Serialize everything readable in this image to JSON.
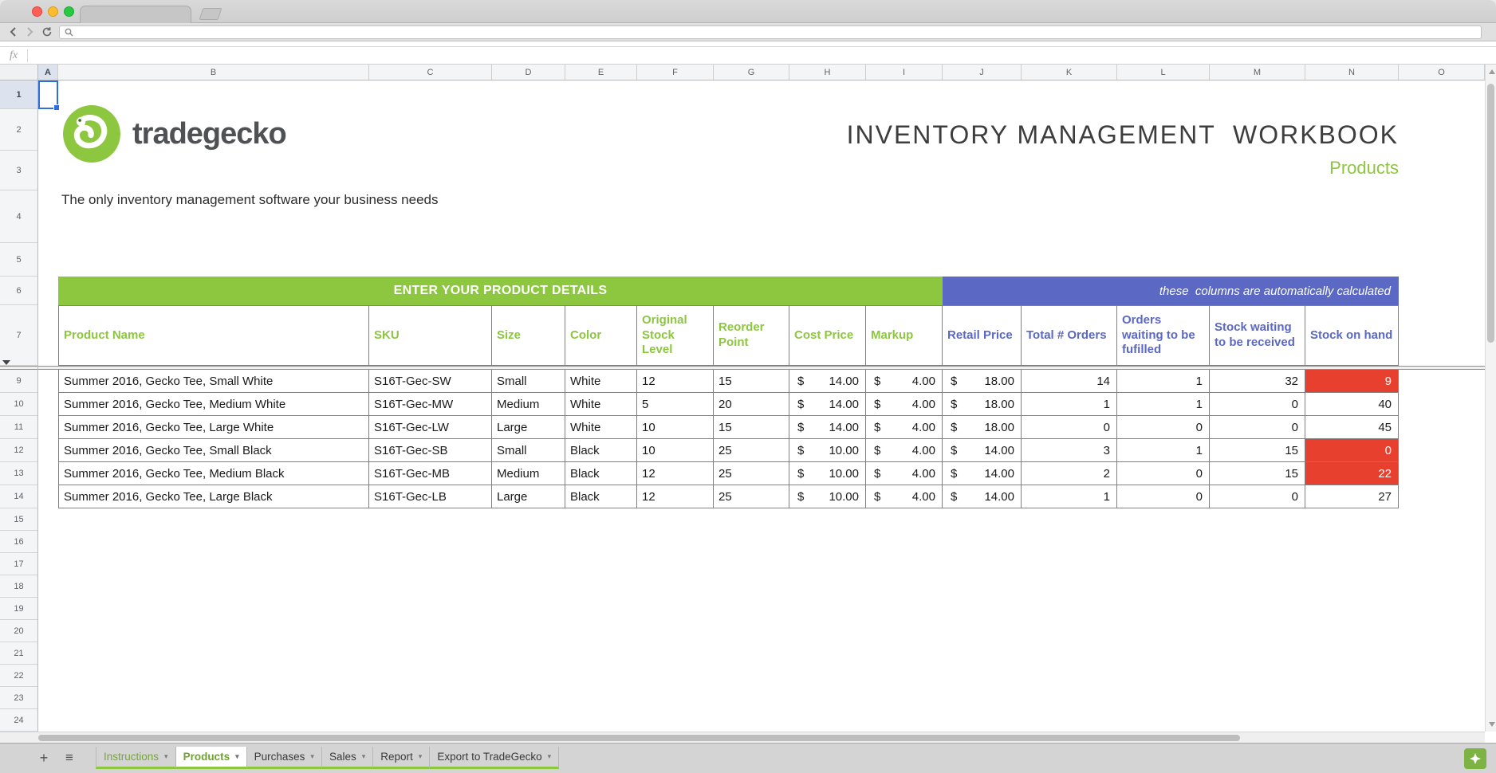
{
  "browser": {
    "tab_title": "",
    "address_value": ""
  },
  "formula_bar": {
    "label": "fx"
  },
  "grid": {
    "column_letters": [
      "A",
      "B",
      "C",
      "D",
      "E",
      "F",
      "G",
      "H",
      "I",
      "J",
      "K",
      "L",
      "M",
      "N",
      "O"
    ],
    "visible_rows": [
      "1",
      "2",
      "3",
      "4",
      "5",
      "6",
      "7",
      "9",
      "10",
      "11",
      "12",
      "13",
      "14",
      "15",
      "16",
      "17",
      "18",
      "19",
      "20",
      "21",
      "22",
      "23",
      "24"
    ],
    "selected_cell": "A1"
  },
  "header_zone": {
    "logo_text": "tradegecko",
    "title": "INVENTORY MANAGEMENT  WORKBOOK",
    "sheet_label": "Products",
    "tagline": "The only inventory management software your business needs"
  },
  "banners": {
    "enter_details": "ENTER YOUR PRODUCT DETAILS",
    "auto_calculated": "these  columns are automatically calculated"
  },
  "table": {
    "currency_symbol": "$",
    "headers": {
      "product_name": "Product Name",
      "sku": "SKU",
      "size": "Size",
      "color": "Color",
      "original_stock": "Original Stock Level",
      "reorder_point": "Reorder Point",
      "cost_price": "Cost Price",
      "markup": "Markup",
      "retail_price": "Retail Price",
      "total_orders": "Total # Orders",
      "orders_waiting": "Orders waiting to be fufilled",
      "stock_waiting": "Stock waiting to be received",
      "stock_on_hand": "Stock on hand"
    },
    "rows": [
      {
        "product": "Summer 2016, Gecko Tee, Small White",
        "sku": "S16T-Gec-SW",
        "size": "Small",
        "color": "White",
        "original_stock": "12",
        "reorder": "15",
        "cost": "14.00",
        "markup": "4.00",
        "retail": "18.00",
        "orders": "14",
        "waiting_fulfil": "1",
        "waiting_receive": "32",
        "on_hand": "9",
        "alert": true
      },
      {
        "product": "Summer 2016, Gecko Tee, Medium White",
        "sku": "S16T-Gec-MW",
        "size": "Medium",
        "color": "White",
        "original_stock": "5",
        "reorder": "20",
        "cost": "14.00",
        "markup": "4.00",
        "retail": "18.00",
        "orders": "1",
        "waiting_fulfil": "1",
        "waiting_receive": "0",
        "on_hand": "40",
        "alert": false
      },
      {
        "product": "Summer 2016, Gecko Tee, Large White",
        "sku": "S16T-Gec-LW",
        "size": "Large",
        "color": "White",
        "original_stock": "10",
        "reorder": "15",
        "cost": "14.00",
        "markup": "4.00",
        "retail": "18.00",
        "orders": "0",
        "waiting_fulfil": "0",
        "waiting_receive": "0",
        "on_hand": "45",
        "alert": false
      },
      {
        "product": "Summer 2016, Gecko Tee, Small Black",
        "sku": "S16T-Gec-SB",
        "size": "Small",
        "color": "Black",
        "original_stock": "10",
        "reorder": "25",
        "cost": "10.00",
        "markup": "4.00",
        "retail": "14.00",
        "orders": "3",
        "waiting_fulfil": "1",
        "waiting_receive": "15",
        "on_hand": "0",
        "alert": true
      },
      {
        "product": "Summer 2016, Gecko Tee, Medium Black",
        "sku": "S16T-Gec-MB",
        "size": "Medium",
        "color": "Black",
        "original_stock": "12",
        "reorder": "25",
        "cost": "10.00",
        "markup": "4.00",
        "retail": "14.00",
        "orders": "2",
        "waiting_fulfil": "0",
        "waiting_receive": "15",
        "on_hand": "22",
        "alert": true
      },
      {
        "product": "Summer 2016, Gecko Tee, Large Black",
        "sku": "S16T-Gec-LB",
        "size": "Large",
        "color": "Black",
        "original_stock": "12",
        "reorder": "25",
        "cost": "10.00",
        "markup": "4.00",
        "retail": "14.00",
        "orders": "1",
        "waiting_fulfil": "0",
        "waiting_receive": "0",
        "on_hand": "27",
        "alert": false
      }
    ]
  },
  "sheet_tabs": {
    "items": [
      {
        "label": "Instructions",
        "active": false
      },
      {
        "label": "Products",
        "active": true
      },
      {
        "label": "Purchases",
        "active": false
      },
      {
        "label": "Sales",
        "active": false
      },
      {
        "label": "Report",
        "active": false
      },
      {
        "label": "Export to TradeGecko",
        "active": false
      }
    ]
  },
  "icons": {
    "add_sheet": "+",
    "all_sheets": "≡",
    "tab_caret": "▾"
  },
  "colors": {
    "brand_green": "#8DC63F",
    "banner_blue": "#5B68C4",
    "alert_red": "#E8402F",
    "selection_blue": "#2e6de5"
  }
}
